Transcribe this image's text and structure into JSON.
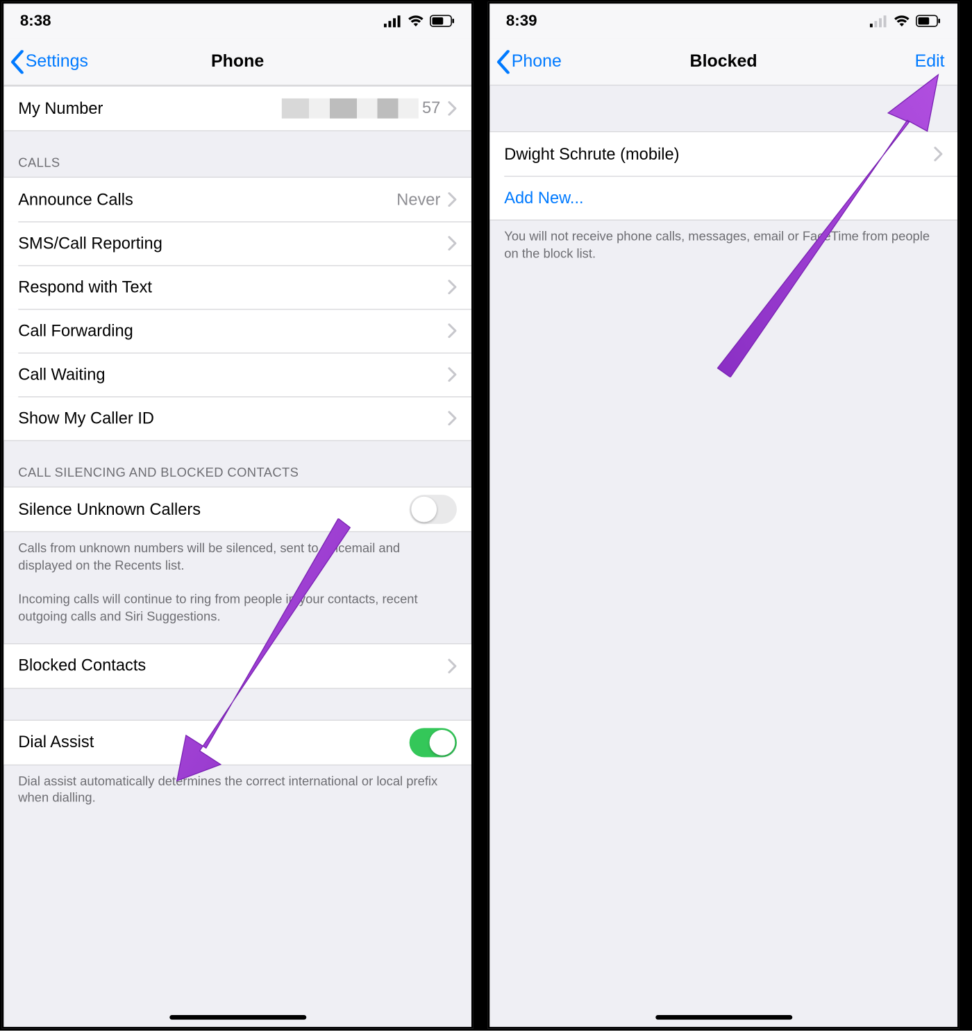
{
  "left": {
    "status_time": "8:38",
    "nav_back": "Settings",
    "nav_title": "Phone",
    "my_number_label": "My Number",
    "my_number_value_tail": "57",
    "section_calls": "CALLS",
    "announce_calls": "Announce Calls",
    "announce_calls_value": "Never",
    "sms_call_reporting": "SMS/Call Reporting",
    "respond_with_text": "Respond with Text",
    "call_forwarding": "Call Forwarding",
    "call_waiting": "Call Waiting",
    "show_caller_id": "Show My Caller ID",
    "section_silencing": "CALL SILENCING AND BLOCKED CONTACTS",
    "silence_unknown": "Silence Unknown Callers",
    "silence_footer1": "Calls from unknown numbers will be silenced, sent to voicemail and displayed on the Recents list.",
    "silence_footer2": "Incoming calls will continue to ring from people in your contacts, recent outgoing calls and Siri Suggestions.",
    "blocked_contacts": "Blocked Contacts",
    "dial_assist": "Dial Assist",
    "dial_assist_footer": "Dial assist automatically determines the correct international or local prefix when dialling."
  },
  "right": {
    "status_time": "8:39",
    "nav_back": "Phone",
    "nav_title": "Blocked",
    "nav_edit": "Edit",
    "blocked_item": "Dwight Schrute (mobile)",
    "add_new": "Add New...",
    "footer": "You will not receive phone calls, messages, email or FaceTime from people on the block list."
  }
}
